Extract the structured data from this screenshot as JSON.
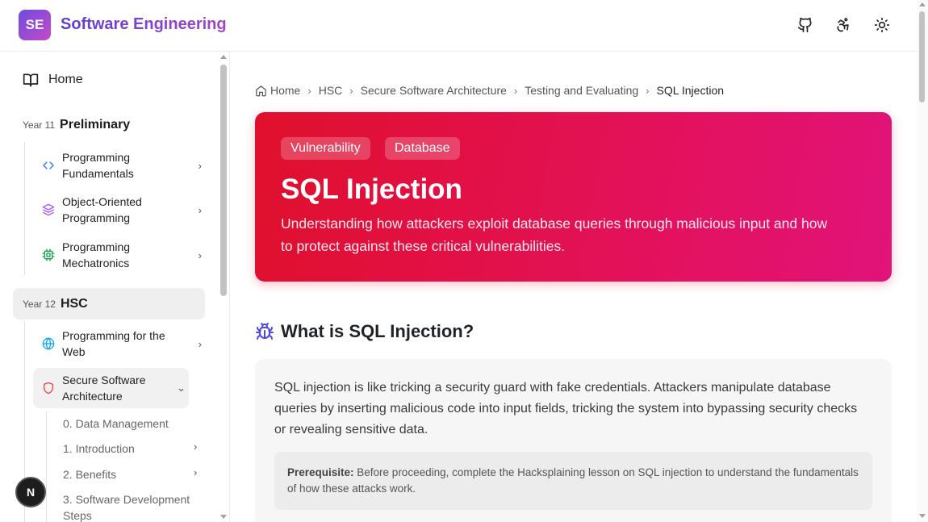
{
  "header": {
    "logo_initials": "SE",
    "site_title": "Software Engineering",
    "icons": [
      "github-icon",
      "accessibility-icon",
      "theme-sun-icon"
    ]
  },
  "sidebar": {
    "home_label": "Home",
    "years": [
      {
        "tag": "Year 11",
        "name": "Preliminary"
      },
      {
        "tag": "Year 12",
        "name": "HSC"
      }
    ],
    "preliminary_items": [
      {
        "label": "Programming Fundamentals",
        "icon": "code-brackets-icon"
      },
      {
        "label": "Object-Oriented Programming",
        "icon": "layers-icon"
      },
      {
        "label": "Programming Mechatronics",
        "icon": "chip-icon"
      }
    ],
    "hsc_items": [
      {
        "label": "Programming for the Web",
        "icon": "globe-icon"
      },
      {
        "label": "Secure Software Architecture",
        "icon": "shield-icon"
      }
    ],
    "sub_items": [
      "0. Data Management",
      "1. Introduction",
      "2. Benefits",
      "3. Software Development Steps"
    ],
    "user_initial": "N"
  },
  "breadcrumb": [
    "Home",
    "HSC",
    "Secure Software Architecture",
    "Testing and Evaluating",
    "SQL Injection"
  ],
  "hero": {
    "tags": [
      "Vulnerability",
      "Database"
    ],
    "title": "SQL Injection",
    "subtitle": "Understanding how attackers exploit database queries through malicious input and how to protect against these critical vulnerabilities."
  },
  "section": {
    "icon": "bug-icon",
    "title": "What is SQL Injection?",
    "body": "SQL injection is like tricking a security guard with fake credentials. Attackers manipulate database queries by inserting malicious code into input fields, tricking the system into bypassing security checks or revealing sensitive data.",
    "prereq_label": "Prerequisite:",
    "prereq_text": " Before proceeding, complete the Hacksplaining lesson on SQL injection to understand the fundamentals of how these attacks work."
  },
  "colors": {
    "brand_purple": "#6d4bdf",
    "hero_red": "#e0102c",
    "hero_pink": "#e2137a"
  }
}
